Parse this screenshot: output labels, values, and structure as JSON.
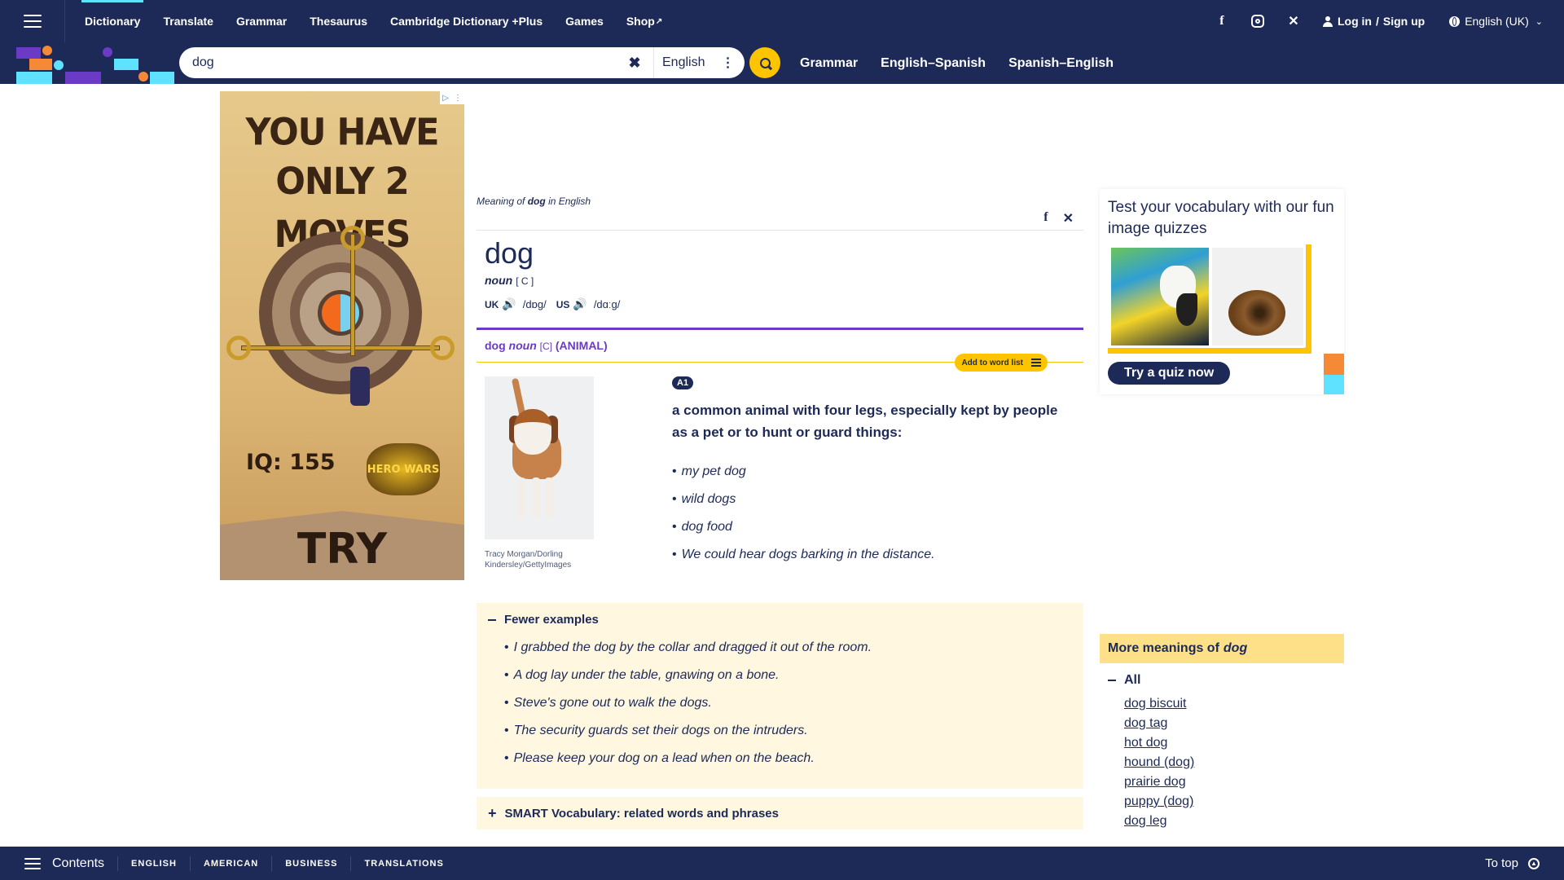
{
  "topnav": {
    "links": [
      "Dictionary",
      "Translate",
      "Grammar",
      "Thesaurus",
      "Cambridge Dictionary +Plus",
      "Games",
      "Shop"
    ],
    "login": "Log in",
    "signup": "Sign up",
    "login_sep": "/",
    "language": "English (UK)",
    "icons": [
      "menu-icon",
      "facebook-icon",
      "instagram-icon",
      "x-icon",
      "user-icon",
      "globe-icon",
      "chevron-down-icon",
      "external-link-icon"
    ]
  },
  "search": {
    "value": "dog",
    "dictionary": "English",
    "links": [
      "Grammar",
      "English–Spanish",
      "Spanish–English"
    ]
  },
  "ad": {
    "title_line1": "YOU HAVE",
    "title_line2": "ONLY 2 MOVES",
    "iq": "IQ: 155",
    "brand": "HERO WARS",
    "cta": "TRY"
  },
  "entry": {
    "meaning_prefix": "Meaning of",
    "meaning_word": "dog",
    "meaning_suffix": "in English",
    "headword": "dog",
    "pos": "noun",
    "grammar": "[ C ]",
    "uk_label": "UK",
    "uk_ipa": "/dɒɡ/",
    "us_label": "US",
    "us_ipa": "/dɑːɡ/",
    "sense": {
      "word": "dog",
      "pos": "noun",
      "grammar": "[C]",
      "guideword": "(ANIMAL)"
    },
    "add_to_word_list": "Add to word list",
    "image_credit": "Tracy Morgan/Dorling Kindersley/GettyImages",
    "level": "A1",
    "definition": "a common animal with four legs, especially kept by people as a pet or to hunt or guard things:",
    "examples": [
      "my pet dog",
      "wild dogs",
      "dog food",
      "We could hear dogs barking in the distance."
    ],
    "fewer_examples": "Fewer examples",
    "more_examples": [
      "I grabbed the dog by the collar and dragged it out of the room.",
      "A dog lay under the table, gnawing on a bone.",
      "Steve's gone out to walk the dogs.",
      "The security guards set their dogs on the intruders.",
      "Please keep your dog on a lead when on the beach."
    ],
    "smart_vocab": "SMART Vocabulary: related words and phrases"
  },
  "quiz": {
    "title": "Test your vocabulary with our fun image quizzes",
    "button": "Try a quiz now"
  },
  "more_meanings": {
    "title_prefix": "More meanings of",
    "title_word": "dog",
    "all_label": "All",
    "items": [
      "dog biscuit",
      "dog tag",
      "hot dog",
      "hound (dog)",
      "prairie dog",
      "puppy (dog)",
      "dog leg"
    ]
  },
  "bottombar": {
    "contents": "Contents",
    "links": [
      "ENGLISH",
      "AMERICAN",
      "BUSINESS",
      "TRANSLATIONS"
    ],
    "to_top": "To top"
  },
  "colors": {
    "navy": "#1d2a57",
    "accent_yellow": "#fec400",
    "purple": "#6c3bc5",
    "cyan": "#5ee2ff",
    "orange": "#f68935",
    "pale_yellow": "#fff7e0"
  }
}
